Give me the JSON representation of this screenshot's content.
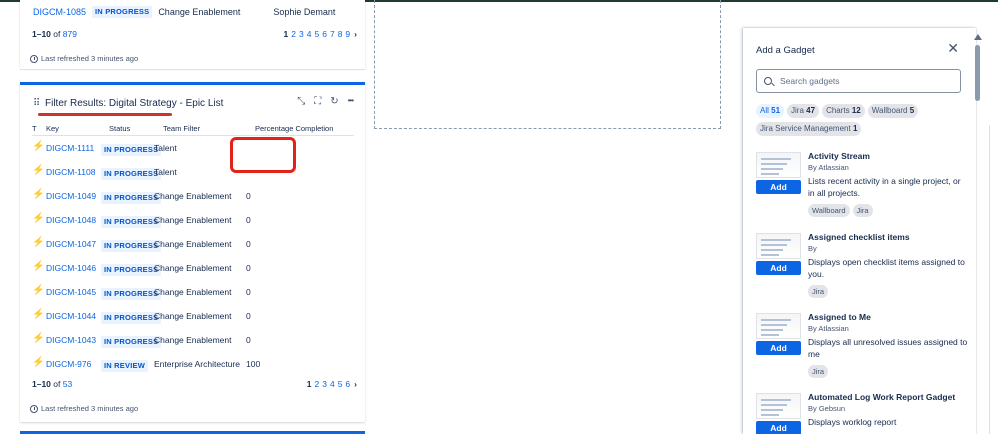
{
  "gadget_top": {
    "row": {
      "key": "DIGCM-1085",
      "status": "IN PROGRESS",
      "team": "Change Enablement",
      "person": "Sophie Demant"
    },
    "range_prefix": "1–10",
    "of_label": "of",
    "total": "879",
    "pages": [
      "1",
      "2",
      "3",
      "4",
      "5",
      "6",
      "7",
      "8",
      "9"
    ],
    "next": "›",
    "refreshed": "Last refreshed 3 minutes ago"
  },
  "gadget_main": {
    "title": "Filter Results: Digital Strategy - Epic List",
    "drag_icon": "⠿",
    "icons": {
      "minimize": "⤡",
      "fullscreen": "⛶",
      "refresh": "↻",
      "more": "•••"
    },
    "columns": {
      "t": "T",
      "key": "Key",
      "status": "Status",
      "team": "Team Filter",
      "pct": "Percentage Completion"
    },
    "rows": [
      {
        "key": "DIGCM-1111",
        "status": "IN PROGRESS",
        "team": "Talent",
        "pct": ""
      },
      {
        "key": "DIGCM-1108",
        "status": "IN PROGRESS",
        "team": "Talent",
        "pct": ""
      },
      {
        "key": "DIGCM-1049",
        "status": "IN PROGRESS",
        "team": "Change Enablement",
        "pct": "0"
      },
      {
        "key": "DIGCM-1048",
        "status": "IN PROGRESS",
        "team": "Change Enablement",
        "pct": "0"
      },
      {
        "key": "DIGCM-1047",
        "status": "IN PROGRESS",
        "team": "Change Enablement",
        "pct": "0"
      },
      {
        "key": "DIGCM-1046",
        "status": "IN PROGRESS",
        "team": "Change Enablement",
        "pct": "0"
      },
      {
        "key": "DIGCM-1045",
        "status": "IN PROGRESS",
        "team": "Change Enablement",
        "pct": "0"
      },
      {
        "key": "DIGCM-1044",
        "status": "IN PROGRESS",
        "team": "Change Enablement",
        "pct": "0"
      },
      {
        "key": "DIGCM-1043",
        "status": "IN PROGRESS",
        "team": "Change Enablement",
        "pct": "0"
      },
      {
        "key": "DIGCM-976",
        "status": "IN REVIEW",
        "team": "Enterprise Architecture",
        "pct": "100"
      }
    ],
    "range_prefix": "1–10",
    "of_label": "of",
    "total": "53",
    "pages": [
      "1",
      "2",
      "3",
      "4",
      "5",
      "6"
    ],
    "next": "›",
    "refreshed": "Last refreshed 3 minutes ago"
  },
  "panel": {
    "title": "Add a Gadget",
    "close": "✕",
    "search_placeholder": "Search gadgets",
    "chips": [
      {
        "label": "All",
        "count": "51"
      },
      {
        "label": "Jira",
        "count": "47"
      },
      {
        "label": "Charts",
        "count": "12"
      },
      {
        "label": "Wallboard",
        "count": "5"
      },
      {
        "label": "Jira Service Management",
        "count": "1"
      }
    ],
    "add_label": "Add",
    "items": [
      {
        "name": "Activity Stream",
        "by": "By Atlassian",
        "desc": "Lists recent activity in a single project, or in all projects.",
        "tags": [
          "Wallboard",
          "Jira"
        ]
      },
      {
        "name": "Assigned checklist items",
        "by": "By",
        "desc": "Displays open checklist items assigned to you.",
        "tags": [
          "Jira"
        ]
      },
      {
        "name": "Assigned to Me",
        "by": "By Atlassian",
        "desc": "Displays all unresolved issues assigned to me",
        "tags": [
          "Jira"
        ]
      },
      {
        "name": "Automated Log Work Report Gadget",
        "by": "By Gebsun",
        "desc": "Displays worklog report",
        "tags": []
      }
    ]
  },
  "colors": {
    "accent": "#0c66e4",
    "annotation": "#e2231a",
    "epic": "#ae4787"
  }
}
